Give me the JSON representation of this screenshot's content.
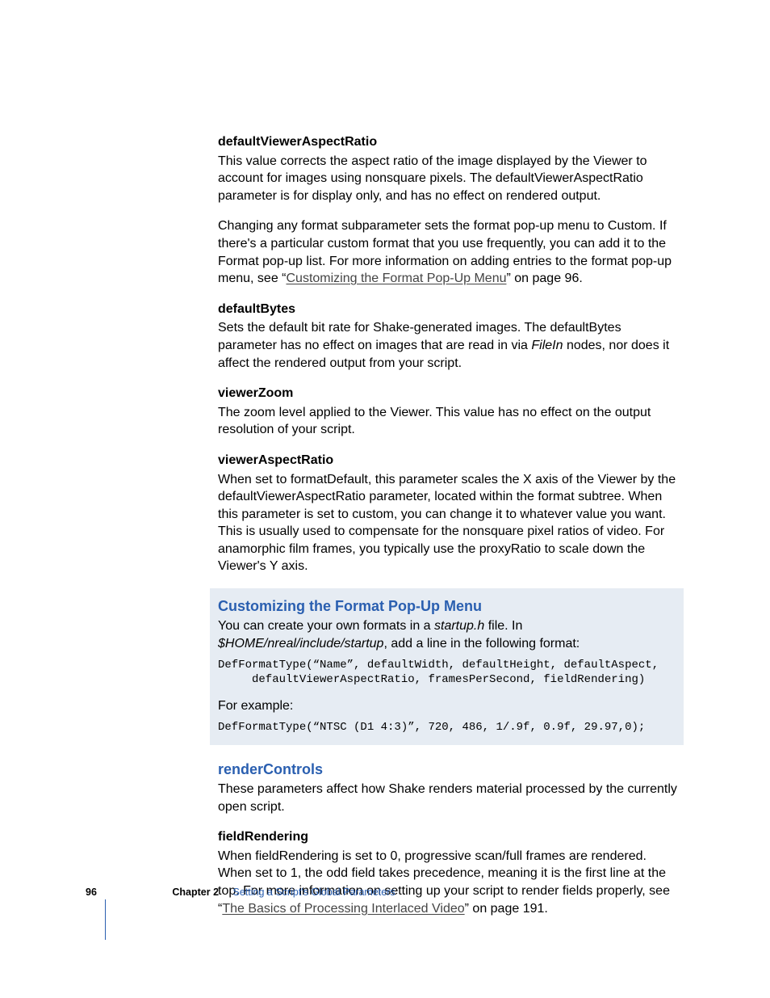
{
  "sections": {
    "dvar": {
      "heading": "defaultViewerAspectRatio",
      "p1": "This value corrects the aspect ratio of the image displayed by the Viewer to account for images using nonsquare pixels. The defaultViewerAspectRatio parameter is for display only, and has no effect on rendered output.",
      "p2_pre": "Changing any format subparameter sets the format pop-up menu to Custom. If there's a particular custom format that you use frequently, you can add it to the Format pop-up list. For more information on adding entries to the format pop-up menu, see “",
      "p2_link": "Customizing the Format Pop-Up Menu",
      "p2_post": "” on page 96."
    },
    "defaultBytes": {
      "heading": "defaultBytes",
      "p_pre": "Sets the default bit rate for Shake-generated images. The defaultBytes parameter has no effect on images that are read in via ",
      "p_italic": "FileIn",
      "p_post": " nodes, nor does it affect the rendered output from your script."
    },
    "viewerZoom": {
      "heading": "viewerZoom",
      "p": "The zoom level applied to the Viewer. This value has no effect on the output resolution of your script."
    },
    "viewerAspectRatio": {
      "heading": "viewerAspectRatio",
      "p": "When set to formatDefault, this parameter scales the X axis of the Viewer by the defaultViewerAspectRatio parameter, located within the format subtree. When this parameter is set to custom, you can change it to whatever value you want. This is usually used to compensate for the nonsquare pixel ratios of video. For anamorphic film frames, you typically use the proxyRatio to scale down the Viewer's Y axis."
    },
    "customizing": {
      "heading": "Customizing the Format Pop-Up Menu",
      "intro_pre": "You can create your own formats in a ",
      "intro_i1": "startup.h",
      "intro_mid": " file. In ",
      "intro_i2": "$HOME/nreal/include/startup",
      "intro_post": ", add a line in the following format:",
      "code1": "DefFormatType(“Name”, defaultWidth, defaultHeight, defaultAspect,\n     defaultViewerAspectRatio, framesPerSecond, fieldRendering)",
      "example_label": "For example:",
      "code2": "DefFormatType(“NTSC (D1 4:3)”, 720, 486, 1/.9f, 0.9f, 29.97,0);"
    },
    "renderControls": {
      "heading": "renderControls",
      "p": "These parameters affect how Shake renders material processed by the currently open script."
    },
    "fieldRendering": {
      "heading": "fieldRendering",
      "p_pre": "When fieldRendering is set to 0, progressive scan/full frames are rendered. When set to 1, the odd field takes precedence, meaning it is the first line at the top. For more information on setting up your script to render fields properly, see “",
      "p_link": "The Basics of Processing Interlaced Video",
      "p_post": "” on page 191."
    }
  },
  "footer": {
    "page": "96",
    "chapter": "Chapter 2",
    "title": "Setting a Script's Global Parameters"
  }
}
